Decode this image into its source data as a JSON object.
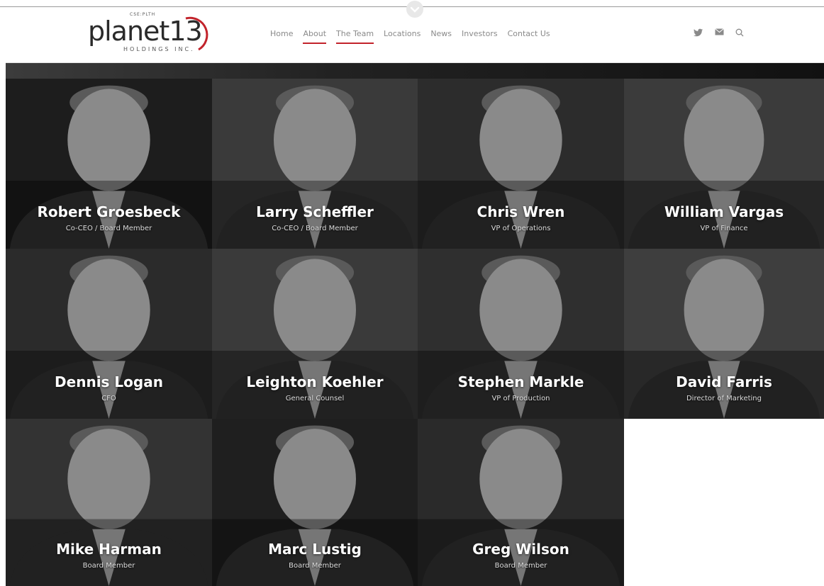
{
  "header": {
    "logo": {
      "tiny_text": "CSE:PLTH",
      "word": "planet13",
      "sub": "HOLDINGS INC."
    },
    "nav": [
      {
        "label": "Home",
        "active": false
      },
      {
        "label": "About",
        "active": true
      },
      {
        "label": "The Team",
        "active": true
      },
      {
        "label": "Locations",
        "active": false
      },
      {
        "label": "News",
        "active": false
      },
      {
        "label": "Investors",
        "active": false
      },
      {
        "label": "Contact Us",
        "active": false
      }
    ],
    "icons": [
      "twitter-icon",
      "email-icon",
      "search-icon"
    ]
  },
  "colors": {
    "accent": "#c2232b",
    "nav_text": "#8a8a8a"
  },
  "team": [
    {
      "name": "Robert Groesbeck",
      "role": "Co-CEO / Board Member"
    },
    {
      "name": "Larry Scheffler",
      "role": "Co-CEO / Board Member"
    },
    {
      "name": "Chris Wren",
      "role": "VP of Operations"
    },
    {
      "name": "William Vargas",
      "role": "VP of Finance"
    },
    {
      "name": "Dennis Logan",
      "role": "CFO"
    },
    {
      "name": "Leighton Koehler",
      "role": "General Counsel"
    },
    {
      "name": "Stephen Markle",
      "role": "VP of Production"
    },
    {
      "name": "David Farris",
      "role": "Director of Marketing"
    },
    {
      "name": "Mike Harman",
      "role": "Board Member"
    },
    {
      "name": "Marc Lustig",
      "role": "Board Member"
    },
    {
      "name": "Greg Wilson",
      "role": "Board Member"
    }
  ]
}
